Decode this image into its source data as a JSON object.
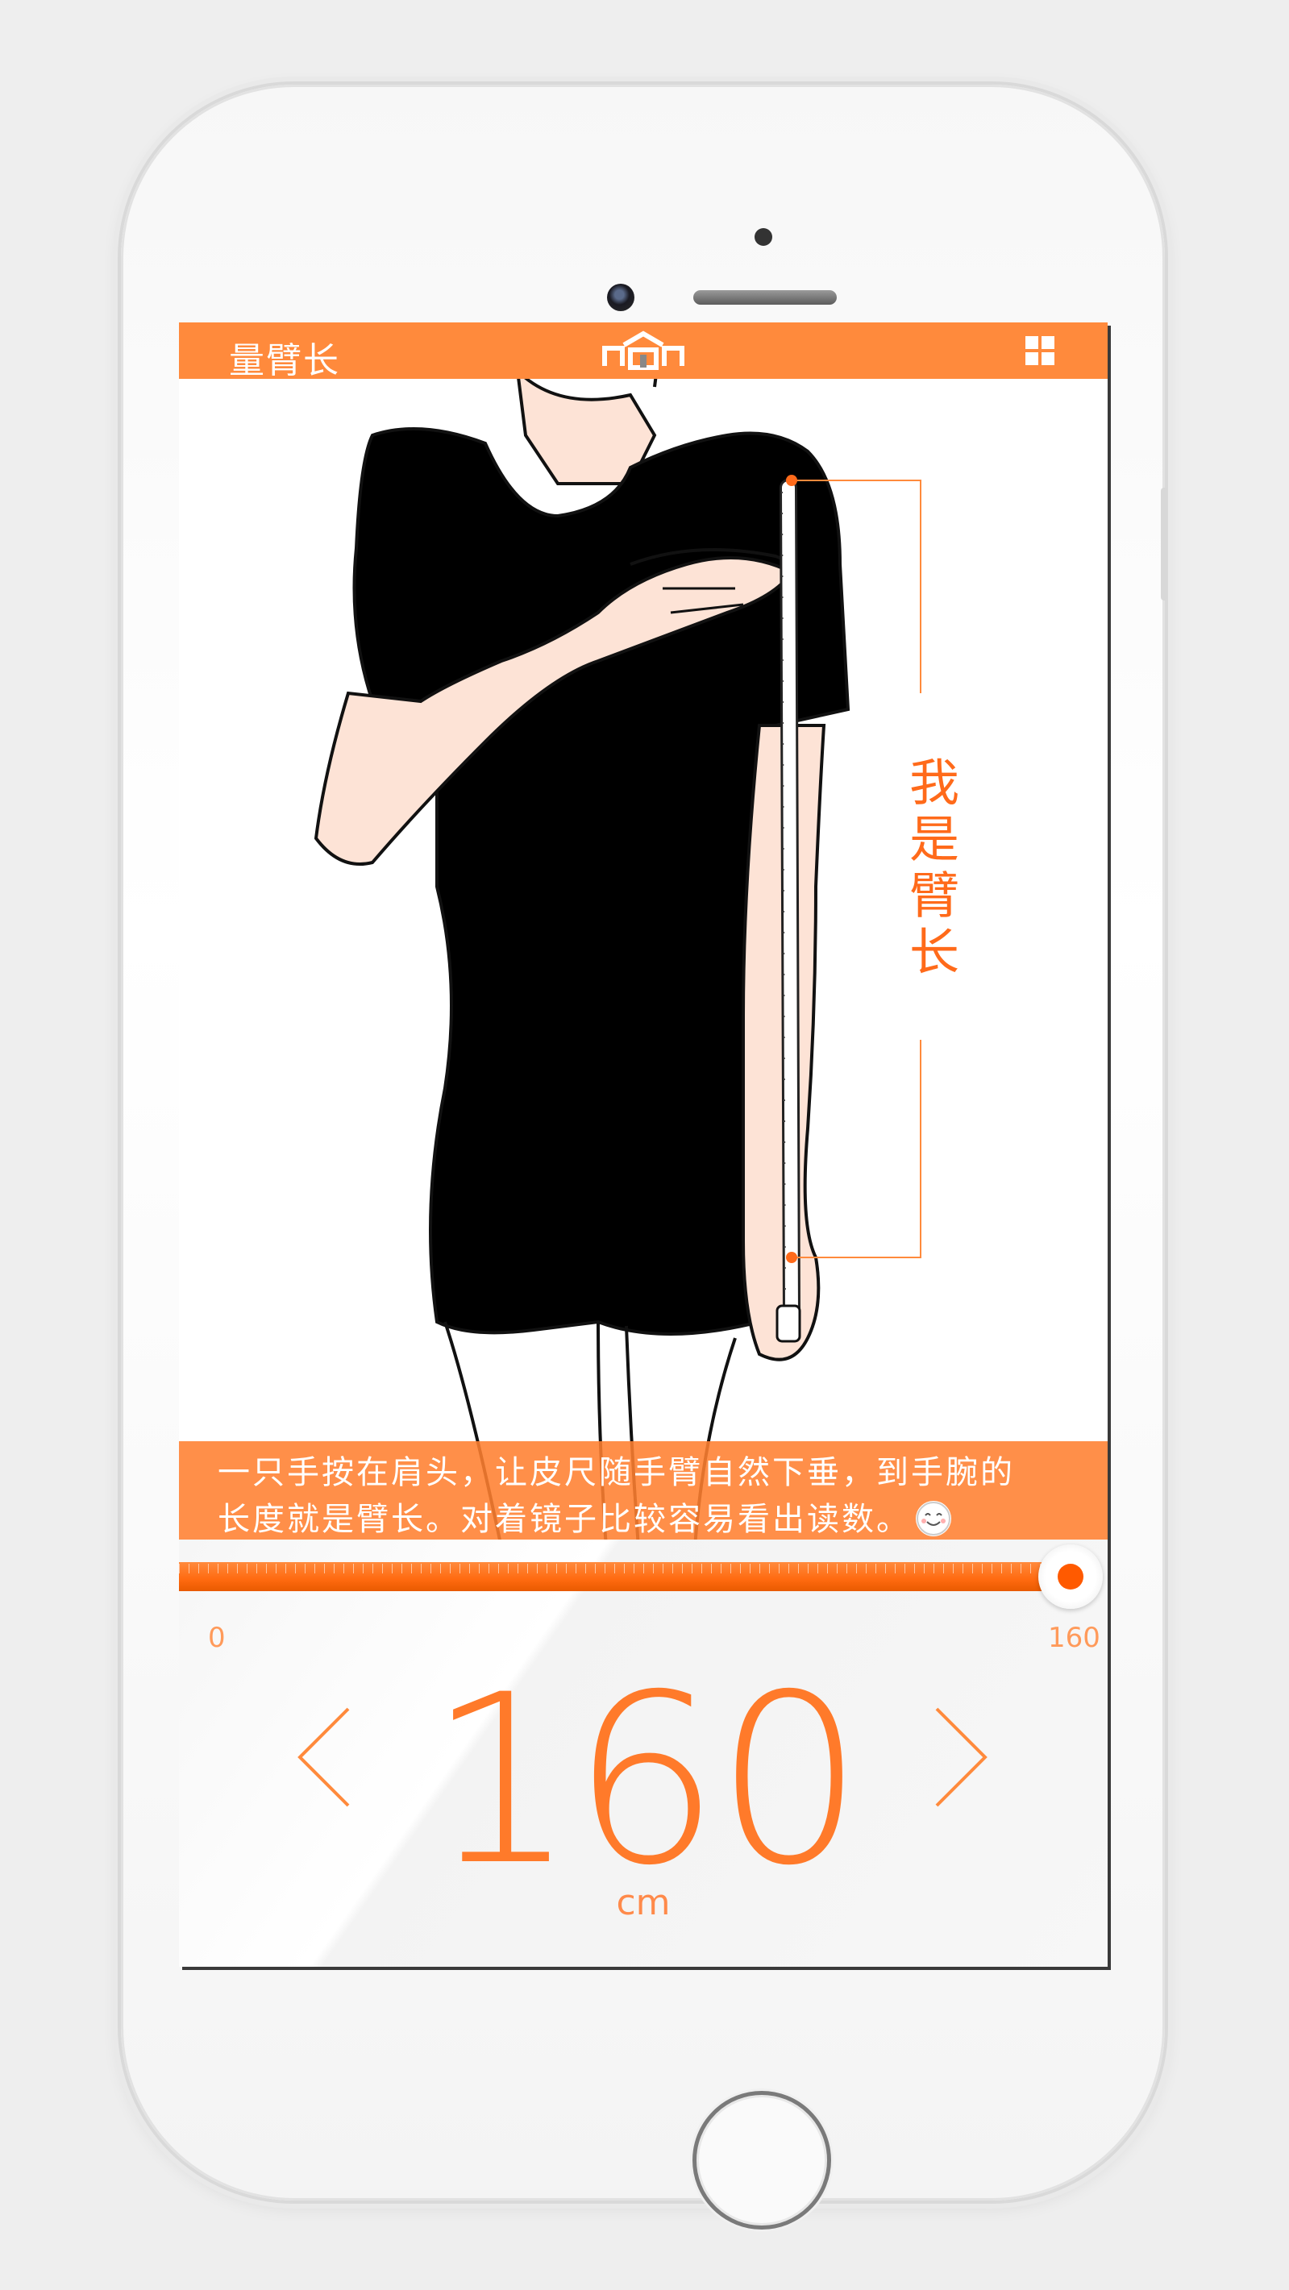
{
  "app": {
    "title": "量臂长",
    "logo_icon": "shop-logo-icon",
    "menu_icon": "grid-icon",
    "accent_color": "#ff8a3c"
  },
  "illustration": {
    "label": "我是臂长"
  },
  "caption": {
    "line1": "一只手按在肩头，让皮尺随手臂自然下垂，到手腕的",
    "line2": "长度就是臂长。对着镜子比较容易看出读数。",
    "emoji_icon": "smiley-icon"
  },
  "slider": {
    "min": "0",
    "max": "160",
    "position_fraction": 1.0
  },
  "measurement": {
    "value": "160",
    "unit": "cm",
    "prev_icon": "chevron-left-icon",
    "next_icon": "chevron-right-icon"
  }
}
